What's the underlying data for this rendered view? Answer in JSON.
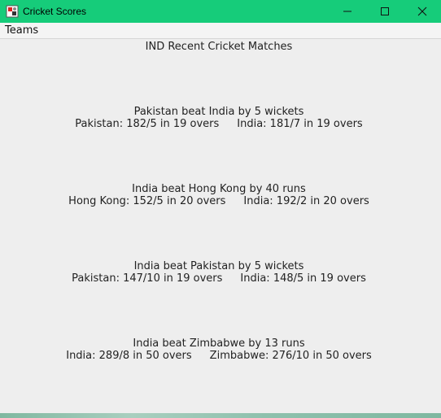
{
  "window": {
    "title": "Cricket Scores",
    "title_bar_color": "#16cc7a",
    "icons": {
      "app": "cricket-app-icon",
      "minimize": "minimize-icon",
      "maximize": "maximize-icon",
      "close": "close-icon"
    }
  },
  "menubar": {
    "items": [
      {
        "label": "Teams"
      }
    ]
  },
  "main": {
    "heading": "IND Recent Cricket Matches",
    "matches": [
      {
        "result": "Pakistan beat India by 5 wickets",
        "team1_score": "Pakistan: 182/5 in 19 overs",
        "team2_score": "India: 181/7 in 19 overs"
      },
      {
        "result": "India beat Hong Kong by 40 runs",
        "team1_score": "Hong Kong: 152/5 in 20 overs",
        "team2_score": "India: 192/2 in 20 overs"
      },
      {
        "result": "India beat Pakistan by 5 wickets",
        "team1_score": "Pakistan: 147/10 in 19 overs",
        "team2_score": "India: 148/5 in 19 overs"
      },
      {
        "result": "India beat Zimbabwe by 13 runs",
        "team1_score": "India: 289/8 in 50 overs",
        "team2_score": "Zimbabwe: 276/10 in 50 overs"
      }
    ]
  }
}
